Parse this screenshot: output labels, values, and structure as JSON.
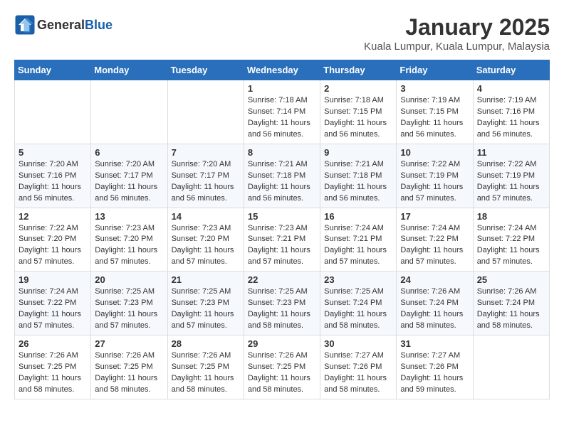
{
  "header": {
    "logo_general": "General",
    "logo_blue": "Blue",
    "month": "January 2025",
    "location": "Kuala Lumpur, Kuala Lumpur, Malaysia"
  },
  "days_of_week": [
    "Sunday",
    "Monday",
    "Tuesday",
    "Wednesday",
    "Thursday",
    "Friday",
    "Saturday"
  ],
  "weeks": [
    [
      {
        "day": "",
        "sunrise": "",
        "sunset": "",
        "daylight": ""
      },
      {
        "day": "",
        "sunrise": "",
        "sunset": "",
        "daylight": ""
      },
      {
        "day": "",
        "sunrise": "",
        "sunset": "",
        "daylight": ""
      },
      {
        "day": "1",
        "sunrise": "7:18 AM",
        "sunset": "7:14 PM",
        "daylight": "11 hours and 56 minutes."
      },
      {
        "day": "2",
        "sunrise": "7:18 AM",
        "sunset": "7:15 PM",
        "daylight": "11 hours and 56 minutes."
      },
      {
        "day": "3",
        "sunrise": "7:19 AM",
        "sunset": "7:15 PM",
        "daylight": "11 hours and 56 minutes."
      },
      {
        "day": "4",
        "sunrise": "7:19 AM",
        "sunset": "7:16 PM",
        "daylight": "11 hours and 56 minutes."
      }
    ],
    [
      {
        "day": "5",
        "sunrise": "7:20 AM",
        "sunset": "7:16 PM",
        "daylight": "11 hours and 56 minutes."
      },
      {
        "day": "6",
        "sunrise": "7:20 AM",
        "sunset": "7:17 PM",
        "daylight": "11 hours and 56 minutes."
      },
      {
        "day": "7",
        "sunrise": "7:20 AM",
        "sunset": "7:17 PM",
        "daylight": "11 hours and 56 minutes."
      },
      {
        "day": "8",
        "sunrise": "7:21 AM",
        "sunset": "7:18 PM",
        "daylight": "11 hours and 56 minutes."
      },
      {
        "day": "9",
        "sunrise": "7:21 AM",
        "sunset": "7:18 PM",
        "daylight": "11 hours and 56 minutes."
      },
      {
        "day": "10",
        "sunrise": "7:22 AM",
        "sunset": "7:19 PM",
        "daylight": "11 hours and 57 minutes."
      },
      {
        "day": "11",
        "sunrise": "7:22 AM",
        "sunset": "7:19 PM",
        "daylight": "11 hours and 57 minutes."
      }
    ],
    [
      {
        "day": "12",
        "sunrise": "7:22 AM",
        "sunset": "7:20 PM",
        "daylight": "11 hours and 57 minutes."
      },
      {
        "day": "13",
        "sunrise": "7:23 AM",
        "sunset": "7:20 PM",
        "daylight": "11 hours and 57 minutes."
      },
      {
        "day": "14",
        "sunrise": "7:23 AM",
        "sunset": "7:20 PM",
        "daylight": "11 hours and 57 minutes."
      },
      {
        "day": "15",
        "sunrise": "7:23 AM",
        "sunset": "7:21 PM",
        "daylight": "11 hours and 57 minutes."
      },
      {
        "day": "16",
        "sunrise": "7:24 AM",
        "sunset": "7:21 PM",
        "daylight": "11 hours and 57 minutes."
      },
      {
        "day": "17",
        "sunrise": "7:24 AM",
        "sunset": "7:22 PM",
        "daylight": "11 hours and 57 minutes."
      },
      {
        "day": "18",
        "sunrise": "7:24 AM",
        "sunset": "7:22 PM",
        "daylight": "11 hours and 57 minutes."
      }
    ],
    [
      {
        "day": "19",
        "sunrise": "7:24 AM",
        "sunset": "7:22 PM",
        "daylight": "11 hours and 57 minutes."
      },
      {
        "day": "20",
        "sunrise": "7:25 AM",
        "sunset": "7:23 PM",
        "daylight": "11 hours and 57 minutes."
      },
      {
        "day": "21",
        "sunrise": "7:25 AM",
        "sunset": "7:23 PM",
        "daylight": "11 hours and 57 minutes."
      },
      {
        "day": "22",
        "sunrise": "7:25 AM",
        "sunset": "7:23 PM",
        "daylight": "11 hours and 58 minutes."
      },
      {
        "day": "23",
        "sunrise": "7:25 AM",
        "sunset": "7:24 PM",
        "daylight": "11 hours and 58 minutes."
      },
      {
        "day": "24",
        "sunrise": "7:26 AM",
        "sunset": "7:24 PM",
        "daylight": "11 hours and 58 minutes."
      },
      {
        "day": "25",
        "sunrise": "7:26 AM",
        "sunset": "7:24 PM",
        "daylight": "11 hours and 58 minutes."
      }
    ],
    [
      {
        "day": "26",
        "sunrise": "7:26 AM",
        "sunset": "7:25 PM",
        "daylight": "11 hours and 58 minutes."
      },
      {
        "day": "27",
        "sunrise": "7:26 AM",
        "sunset": "7:25 PM",
        "daylight": "11 hours and 58 minutes."
      },
      {
        "day": "28",
        "sunrise": "7:26 AM",
        "sunset": "7:25 PM",
        "daylight": "11 hours and 58 minutes."
      },
      {
        "day": "29",
        "sunrise": "7:26 AM",
        "sunset": "7:25 PM",
        "daylight": "11 hours and 58 minutes."
      },
      {
        "day": "30",
        "sunrise": "7:27 AM",
        "sunset": "7:26 PM",
        "daylight": "11 hours and 58 minutes."
      },
      {
        "day": "31",
        "sunrise": "7:27 AM",
        "sunset": "7:26 PM",
        "daylight": "11 hours and 59 minutes."
      },
      {
        "day": "",
        "sunrise": "",
        "sunset": "",
        "daylight": ""
      }
    ]
  ]
}
